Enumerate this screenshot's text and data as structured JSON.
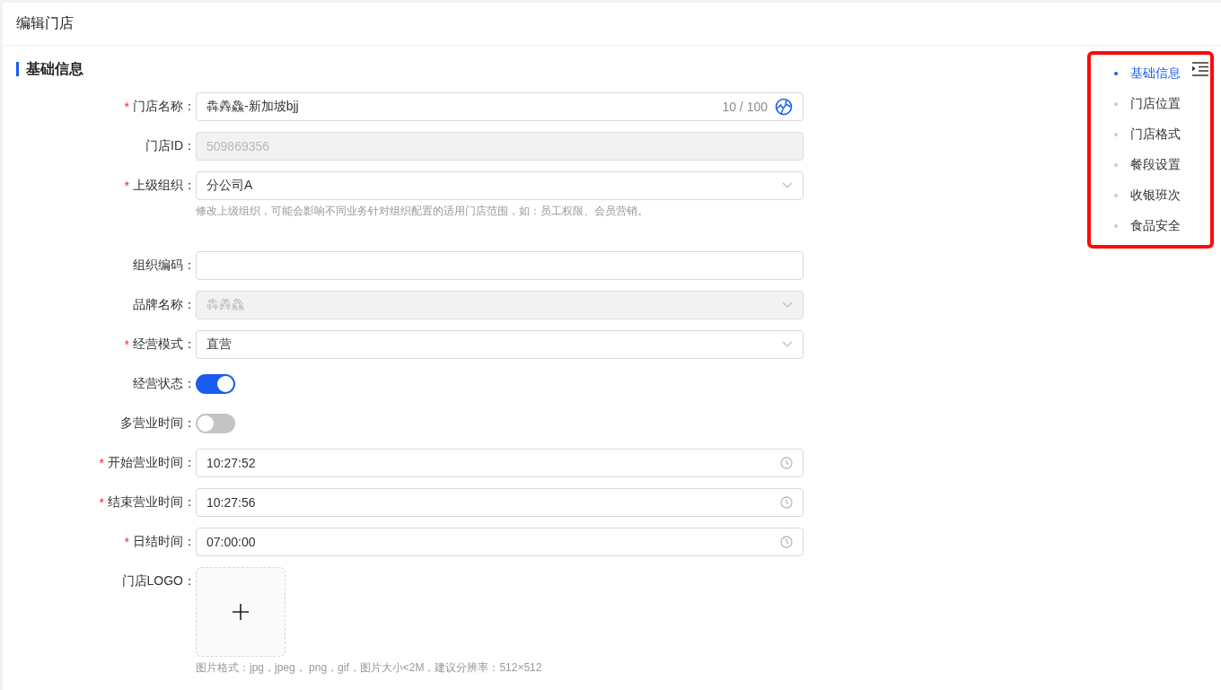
{
  "page": {
    "title": "编辑门店"
  },
  "section": {
    "title": "基础信息"
  },
  "fields": [
    {
      "kind": "text",
      "label": "门店名称：",
      "required_mark": "*",
      "disabled": false,
      "value": "犇羴鱻-新加坡bjj",
      "counter": "10 / 100"
    },
    {
      "kind": "text",
      "label": "门店ID：",
      "disabled": true,
      "value": "509869356"
    },
    {
      "kind": "select",
      "label": "上级组织：",
      "required_mark": "*",
      "disabled": false,
      "value": "分公司A",
      "hint": "修改上级组织，可能会影响不同业务针对组织配置的适用门店范围，如：员工权限、会员营销。"
    },
    {
      "kind": "text",
      "label": "组织编码："
    },
    {
      "kind": "select",
      "label": "品牌名称：",
      "disabled": true,
      "value": "犇羴鱻"
    },
    {
      "kind": "select",
      "label": "经营模式：",
      "required_mark": "*",
      "disabled": false,
      "value": "直营"
    },
    {
      "kind": "switch",
      "label": "经营状态：",
      "on": true
    },
    {
      "kind": "switch",
      "label": "多营业时间：",
      "on": false
    },
    {
      "kind": "time",
      "label": "开始营业时间：",
      "required_mark": "*",
      "value": "10:27:52"
    },
    {
      "kind": "time",
      "label": "结束营业时间：",
      "required_mark": "*",
      "value": "10:27:56"
    },
    {
      "kind": "time",
      "label": "日结时间：",
      "required_mark": "*",
      "value": "07:00:00"
    },
    {
      "kind": "upload",
      "label": "门店LOGO：",
      "hint": "图片格式：jpg，jpeg， png，gif，图片大小<2M，建议分辨率：512×512"
    }
  ],
  "anchor": {
    "highlighted": true,
    "items": [
      {
        "label": "基础信息",
        "selected": true
      },
      {
        "label": "门店位置",
        "selected": false
      },
      {
        "label": "门店格式",
        "selected": false
      },
      {
        "label": "餐段设置",
        "selected": false
      },
      {
        "label": "收银班次",
        "selected": false
      },
      {
        "label": "食品安全",
        "selected": false
      }
    ]
  }
}
